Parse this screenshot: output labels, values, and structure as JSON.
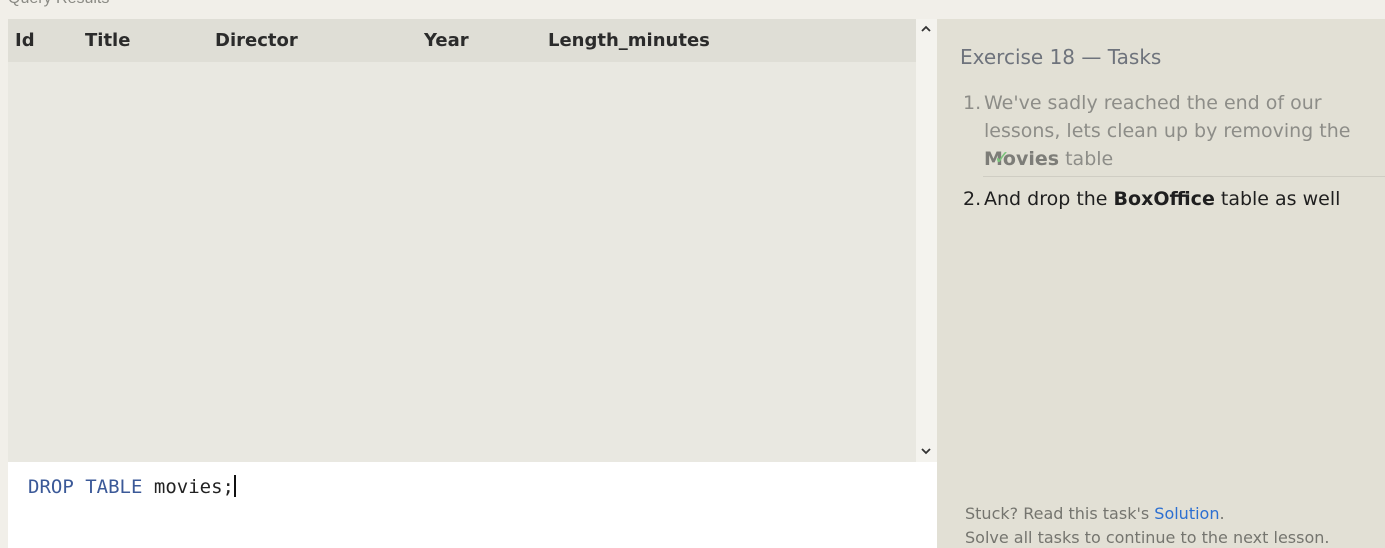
{
  "results_section": {
    "label": "Query Results",
    "columns": [
      "Id",
      "Title",
      "Director",
      "Year",
      "Length_minutes"
    ],
    "rows": []
  },
  "editor": {
    "keyword_1": "DROP",
    "keyword_2": "TABLE",
    "identifier": "movies;"
  },
  "tasks": {
    "title": "Exercise 18 — Tasks",
    "items": [
      {
        "number": "1.",
        "text_before": "We've sadly reached the end of our lessons, lets clean up by removing the ",
        "bold": "Movies",
        "text_after": " table",
        "status": "done",
        "check_icon": "✓"
      },
      {
        "number": "2.",
        "text_before": "And drop the ",
        "bold": "BoxOffice",
        "text_after": " table as well",
        "status": "active"
      }
    ],
    "footer": {
      "stuck_prefix": "Stuck? Read this task's ",
      "solution_link": "Solution",
      "stuck_suffix": ".",
      "continue_text": "Solve all tasks to continue to the next lesson."
    }
  },
  "colors": {
    "keyword": "#3b5998",
    "link": "#2c6fd1",
    "check": "#7bc47b"
  }
}
